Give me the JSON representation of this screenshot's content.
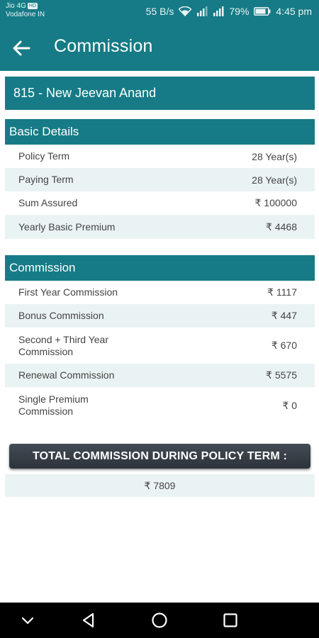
{
  "status_bar": {
    "carrier1": "Jio 4G",
    "volte": "HD",
    "carrier2": "Vodafone IN",
    "speed": "55 B/s",
    "battery": "79%",
    "time": "4:45 pm"
  },
  "app_bar": {
    "title": "Commission"
  },
  "plan": {
    "name": "815 - New Jeevan Anand"
  },
  "basic_details": {
    "header": "Basic Details",
    "rows": [
      {
        "label": "Policy Term",
        "value": "28 Year(s)"
      },
      {
        "label": "Paying Term",
        "value": "28 Year(s)"
      },
      {
        "label": "Sum Assured",
        "value": "₹ 100000"
      },
      {
        "label": "Yearly Basic Premium",
        "value": "₹ 4468"
      }
    ]
  },
  "commission": {
    "header": "Commission",
    "rows": [
      {
        "label": "First Year Commission",
        "value": "₹ 1117"
      },
      {
        "label": "Bonus Commission",
        "value": "₹ 447"
      },
      {
        "label": "Second + Third Year Commission",
        "value": "₹ 670"
      },
      {
        "label": "Renewal Commission",
        "value": "₹ 5575"
      },
      {
        "label": "Single Premium Commission",
        "value": "₹ 0"
      }
    ]
  },
  "total": {
    "label": "TOTAL COMMISSION DURING POLICY TERM :",
    "value": "₹ 7809"
  },
  "icons": {
    "back": "arrow-back-icon",
    "nav_down": "chevron-down-icon",
    "nav_back": "triangle-back-icon",
    "nav_home": "circle-home-icon",
    "nav_recents": "square-recents-icon"
  },
  "colors": {
    "primary": "#167b86",
    "row_alt": "#eaf3f3",
    "total_button": "#3a424b"
  }
}
